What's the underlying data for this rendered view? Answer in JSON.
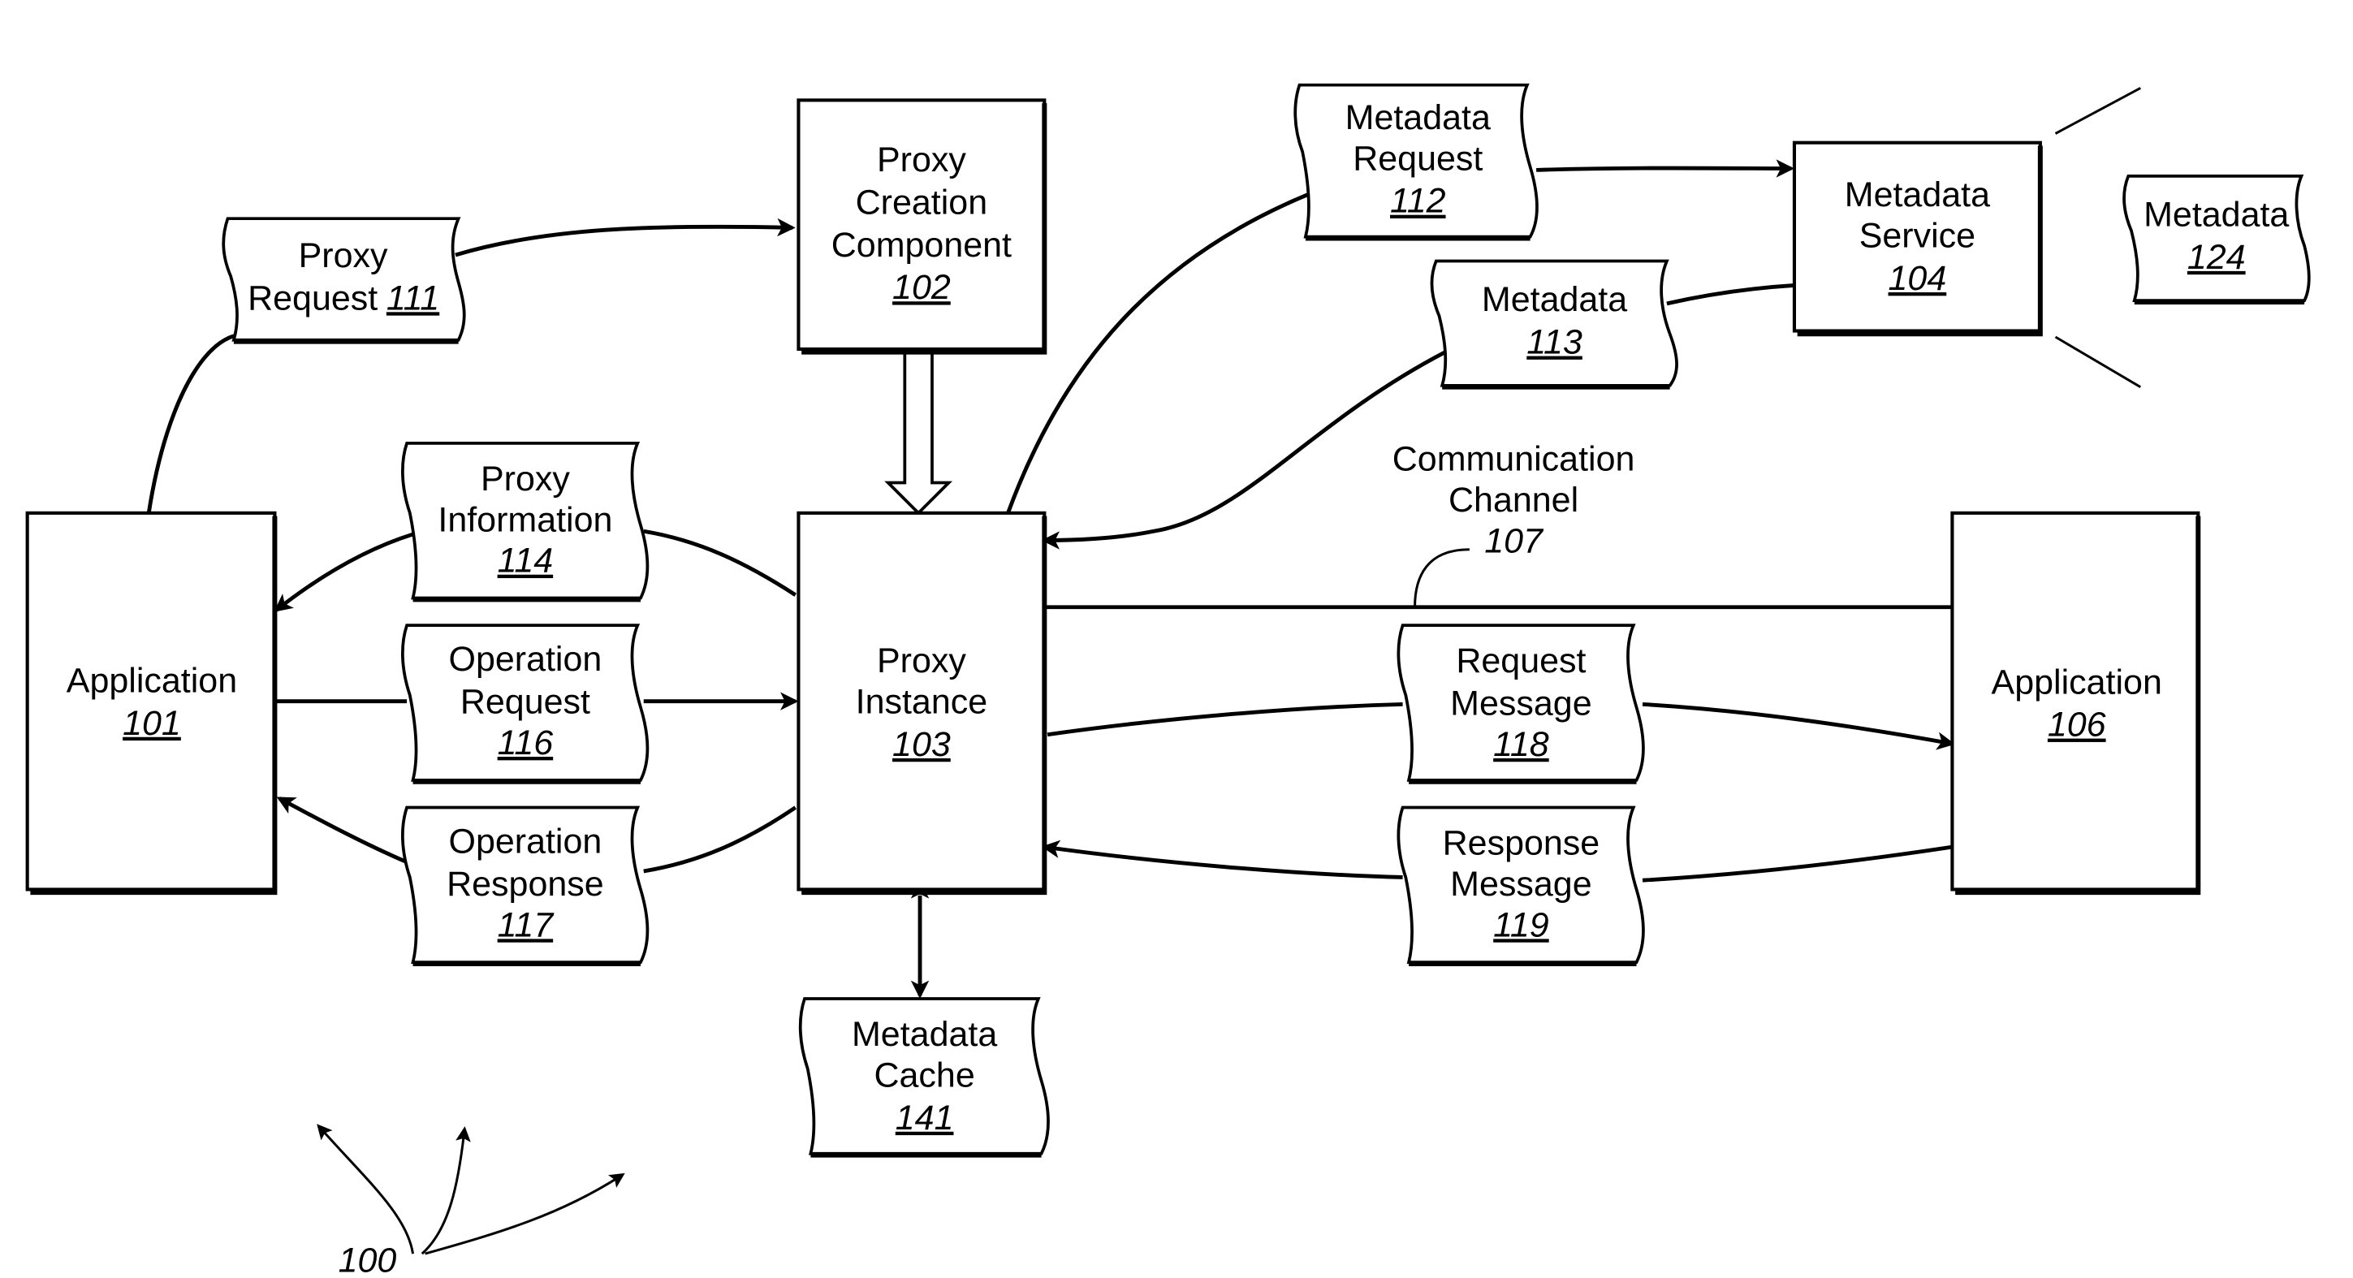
{
  "figure_label": "100",
  "components": {
    "application_101": {
      "lines": [
        "Application"
      ],
      "ref": "101"
    },
    "proxy_creation_102": {
      "lines": [
        "Proxy",
        "Creation",
        "Component"
      ],
      "ref": "102"
    },
    "proxy_instance_103": {
      "lines": [
        "Proxy",
        "Instance"
      ],
      "ref": "103"
    },
    "metadata_service_104": {
      "lines": [
        "Metadata",
        "Service"
      ],
      "ref": "104"
    },
    "application_106": {
      "lines": [
        "Application"
      ],
      "ref": "106"
    }
  },
  "documents": {
    "proxy_request_111": {
      "lines": [
        "Proxy",
        "Request"
      ],
      "ref": "111"
    },
    "metadata_request_112": {
      "lines": [
        "Metadata",
        "Request"
      ],
      "ref": "112"
    },
    "metadata_113": {
      "lines": [
        "Metadata"
      ],
      "ref": "113"
    },
    "proxy_information_114": {
      "lines": [
        "Proxy",
        "Information"
      ],
      "ref": "114"
    },
    "operation_request_116": {
      "lines": [
        "Operation",
        "Request"
      ],
      "ref": "116"
    },
    "operation_response_117": {
      "lines": [
        "Operation",
        "Response"
      ],
      "ref": "117"
    },
    "request_message_118": {
      "lines": [
        "Request",
        "Message"
      ],
      "ref": "118"
    },
    "response_message_119": {
      "lines": [
        "Response",
        "Message"
      ],
      "ref": "119"
    },
    "metadata_124": {
      "lines": [
        "Metadata"
      ],
      "ref": "124"
    },
    "metadata_cache_141": {
      "lines": [
        "Metadata",
        "Cache"
      ],
      "ref": "141"
    }
  },
  "channel": {
    "lines": [
      "Communication",
      "Channel"
    ],
    "ref": "107"
  }
}
